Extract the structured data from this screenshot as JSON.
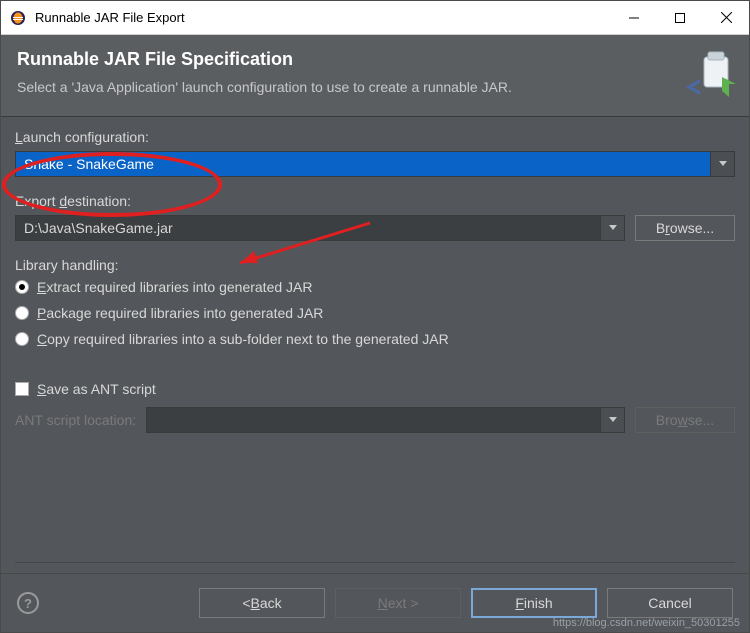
{
  "window": {
    "title": "Runnable JAR File Export"
  },
  "header": {
    "title": "Runnable JAR File Specification",
    "desc": "Select a 'Java Application' launch configuration to use to create a runnable JAR."
  },
  "labels": {
    "launch_config": "Launch configuration:",
    "export_dest": "Export destination:",
    "library_handling": "Library handling:",
    "ant_script": "Save as ANT script",
    "ant_location": "ANT script location:"
  },
  "values": {
    "launch_config": "Snake - SnakeGame",
    "export_dest": "D:\\Java\\SnakeGame.jar"
  },
  "buttons": {
    "browse": "Browse...",
    "browse2": "Browse...",
    "back": "< Back",
    "next": "Next >",
    "finish": "Finish",
    "cancel": "Cancel"
  },
  "radios": [
    "Extract required libraries into generated JAR",
    "Package required libraries into generated JAR",
    "Copy required libraries into a sub-folder next to the generated JAR"
  ],
  "watermark": "https://blog.csdn.net/weixin_50301255"
}
